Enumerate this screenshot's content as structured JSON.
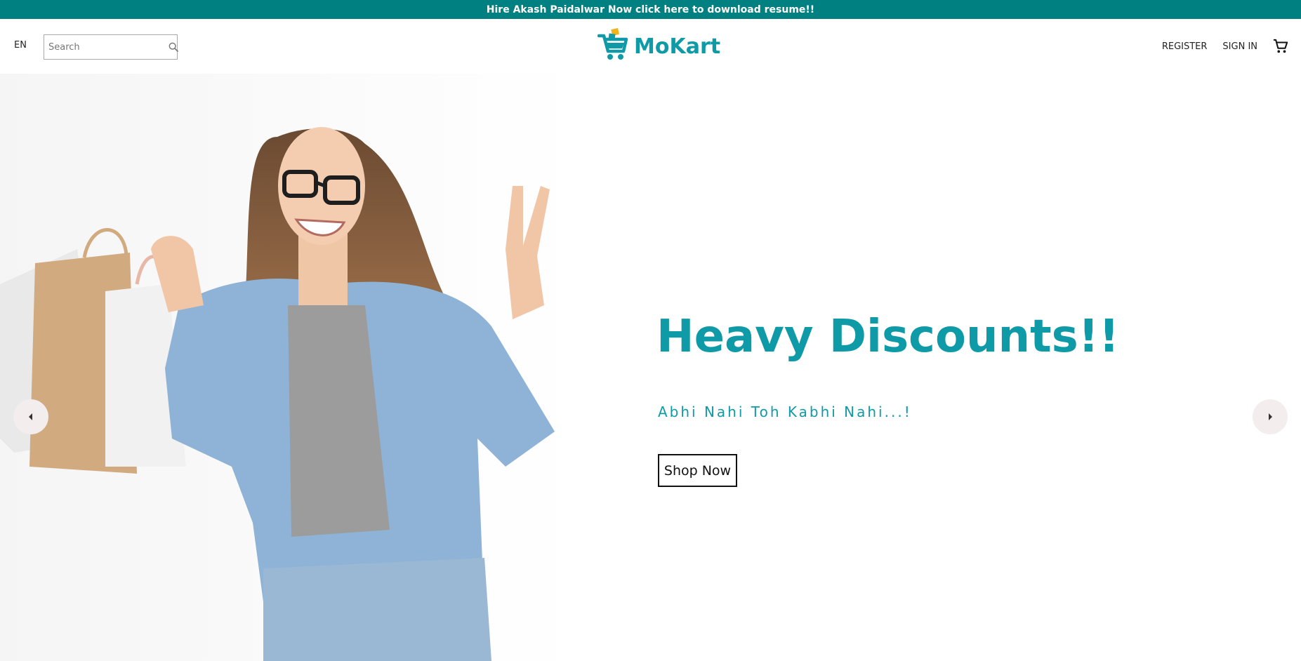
{
  "announcement": {
    "text": "Hire Akash Paidalwar Now click here to download resume!!"
  },
  "header": {
    "language": "EN",
    "search": {
      "placeholder": "Search",
      "value": ""
    },
    "logo_text": "MoKart",
    "nav": {
      "register": "REGISTER",
      "sign_in": "SIGN IN"
    }
  },
  "hero": {
    "title": "Heavy Discounts!!",
    "subtitle": "Abhi Nahi Toh Kabhi Nahi...!",
    "cta": "Shop Now"
  },
  "colors": {
    "brand_teal": "#008080",
    "accent": "#0f9aa7",
    "logo_yellow": "#f2b21b",
    "arrow_bg": "#f3eded"
  },
  "icons": [
    "search-icon",
    "cart-icon",
    "chevron-left-icon",
    "chevron-right-icon",
    "logo-cart-icon"
  ]
}
